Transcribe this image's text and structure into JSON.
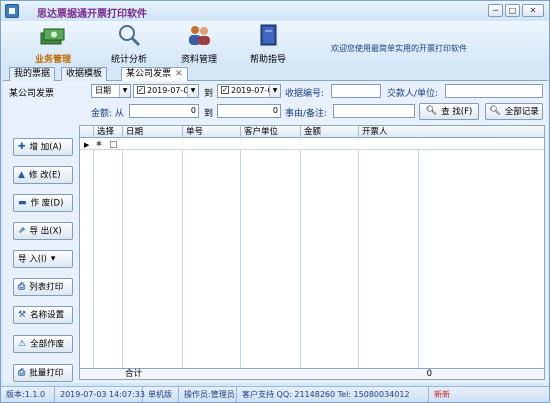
{
  "window": {
    "title": "思达票据通开票打印软件",
    "controls": {
      "minimize": "─",
      "maximize": "□",
      "close": "✕"
    }
  },
  "toolbar": {
    "items": [
      {
        "label": "业务管理",
        "icon": "money-cards-icon",
        "active": true
      },
      {
        "label": "统计分析",
        "icon": "magnifier-icon",
        "active": false
      },
      {
        "label": "资料管理",
        "icon": "users-icon",
        "active": false
      },
      {
        "label": "帮助指导",
        "icon": "help-book-icon",
        "active": false
      }
    ],
    "message": "欢迎您使用最简单实用的开票打印软件"
  },
  "tabs": [
    {
      "label": "我的票据"
    },
    {
      "label": "收据模板"
    },
    {
      "label": "某公司发票",
      "close": "✕"
    }
  ],
  "filter": {
    "panel_title": "某公司发票",
    "date_type": "日期",
    "date_from": "2019-07-03",
    "to1": "到",
    "date_to": "2019-07-03",
    "receipt_no_label": "收据编号:",
    "receipt_no_value": "",
    "payer_label": "交款人/单位:",
    "payer_value": "",
    "amount_label": "金额: 从",
    "amount_from": "0",
    "to2": "到",
    "amount_to": "0",
    "remark_label": "事由/备注:",
    "remark_value": "",
    "search_button": "查 找(F)",
    "all_button": "全部记录"
  },
  "side_buttons": [
    {
      "label": "增 加(A)",
      "icon": "add-icon",
      "glyph": "✚"
    },
    {
      "label": "修 改(E)",
      "icon": "edit-icon",
      "glyph": "▲"
    },
    {
      "label": "作 废(D)",
      "icon": "void-icon",
      "glyph": "▬"
    },
    {
      "label": "导 出(X)",
      "icon": "export-icon",
      "glyph": "⇗"
    },
    {
      "label": "导 入(I)",
      "icon": "import-dropdown-icon",
      "glyph": "▾"
    },
    {
      "label": "列表打印",
      "icon": "print-list-icon",
      "glyph": "⎙"
    },
    {
      "label": "名称设置",
      "icon": "name-settings-icon",
      "glyph": "⚒"
    },
    {
      "label": "全部作废",
      "icon": "void-all-icon",
      "glyph": "⚠"
    },
    {
      "label": "批量打印",
      "icon": "batch-print-icon",
      "glyph": "⎙"
    }
  ],
  "grid": {
    "columns": [
      "选择",
      "日期",
      "单号",
      "客户单位",
      "金额",
      "开票人"
    ],
    "row_marker": "▶",
    "row_star": "✱",
    "footer_label": "合计",
    "footer_total": "0"
  },
  "statusbar": {
    "version": "版本:1.1.0",
    "datetime": "2019-07-03 14:07:33",
    "edition": "单机版",
    "operator": "操作员:管理员",
    "support": "客户支持 QQ: 21148260 Tel: 15080034012",
    "extra": "新新"
  },
  "colors": {
    "title": "#7a2a8c",
    "active_tool": "#c26a00",
    "accent_blue": "#1f5fae",
    "window_bg": "#d6e8f7"
  }
}
